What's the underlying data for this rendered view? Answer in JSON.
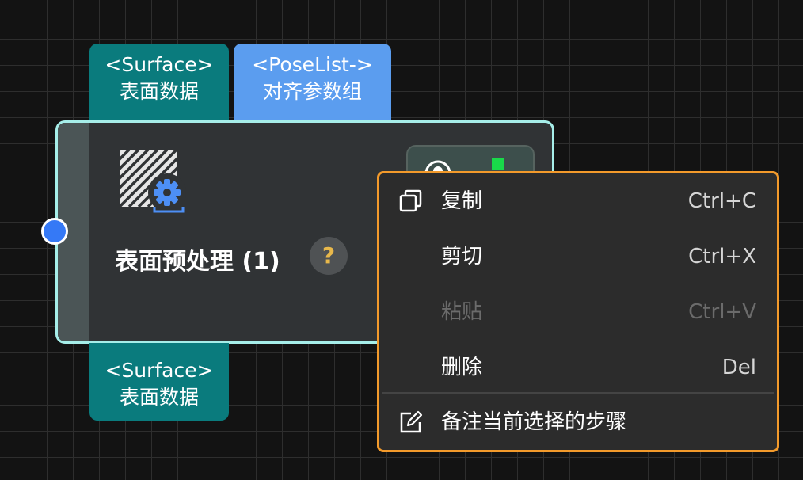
{
  "ports": {
    "input1": {
      "line1": "<Surface>",
      "line2": "表面数据",
      "color": "#0a7b7d"
    },
    "input2": {
      "line1": "<PoseList->",
      "line2": "对齐参数组",
      "color": "#5b9def"
    },
    "output1": {
      "line1": "<Surface>",
      "line2": "表面数据",
      "color": "#0a7b7d"
    }
  },
  "node": {
    "title": "表面预处理 (1)",
    "help_symbol": "?",
    "icon": "hatched-square-gear-icon",
    "status_led_color": "#19d94a",
    "border_color": "#a6eee9"
  },
  "context_menu": {
    "border_color": "#f39a2b",
    "items": [
      {
        "icon": "copy-icon",
        "label": "复制",
        "shortcut": "Ctrl+C",
        "enabled": true
      },
      {
        "label": "剪切",
        "shortcut": "Ctrl+X",
        "enabled": true
      },
      {
        "label": "粘贴",
        "shortcut": "Ctrl+V",
        "enabled": false
      },
      {
        "label": "删除",
        "shortcut": "Del",
        "enabled": true
      },
      {
        "icon": "edit-note-icon",
        "label": "备注当前选择的步骤",
        "enabled": true
      }
    ]
  }
}
